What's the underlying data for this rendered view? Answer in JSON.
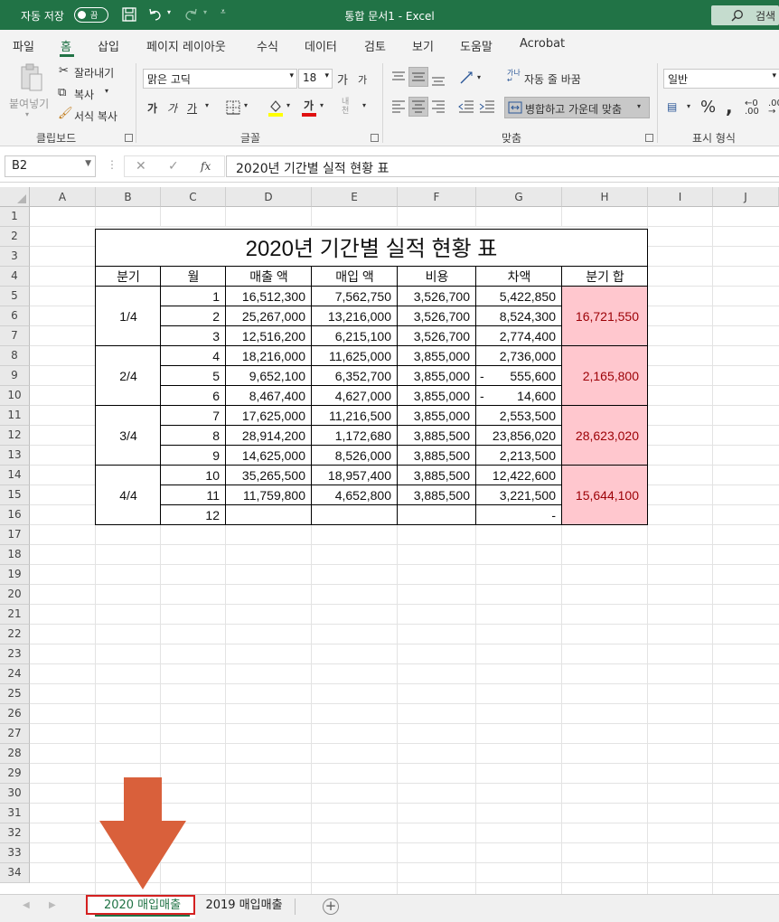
{
  "titlebar": {
    "autosave_label": "자동 저장",
    "autosave_state": "끔",
    "doc_title": "통합 문서1  -  Excel",
    "search_label": "검색",
    "accent_color": "#217346"
  },
  "ribbon_tabs": [
    "파일",
    "홈",
    "삽입",
    "페이지 레이아웃",
    "수식",
    "데이터",
    "검토",
    "보기",
    "도움말",
    "Acrobat"
  ],
  "active_tab": "홈",
  "ribbon": {
    "clipboard": {
      "paste": "붙여넣기",
      "cut": "잘라내기",
      "copy": "복사",
      "format_painter": "서식 복사",
      "label": "클립보드"
    },
    "font": {
      "font_name": "맑은 고딕",
      "font_size": "18",
      "grow": "가",
      "shrink": "가",
      "bold": "가",
      "italic": "가",
      "underline": "가",
      "font_color_glyph": "가",
      "phonetic": "내천",
      "label": "글꼴"
    },
    "alignment": {
      "wrap_text": "자동 줄 바꿈",
      "merge_center": "병합하고 가운데 맞춤",
      "label": "맞춤"
    },
    "number": {
      "format": "일반",
      "percent": "%",
      "comma": ",",
      "label": "표시 형식"
    }
  },
  "formula_bar": {
    "name_box": "B2",
    "formula": "2020년 기간별 실적 현황 표",
    "cancel": "✕",
    "enter": "✓",
    "fx": "fx"
  },
  "columns": [
    "A",
    "B",
    "C",
    "D",
    "E",
    "F",
    "G",
    "H",
    "I",
    "J"
  ],
  "rows": [
    "1",
    "2",
    "3",
    "4",
    "5",
    "6",
    "7",
    "8",
    "9",
    "10",
    "11",
    "12",
    "13",
    "14",
    "15",
    "16",
    "17",
    "18",
    "19",
    "20",
    "21",
    "22",
    "23",
    "24",
    "25",
    "26",
    "27",
    "28",
    "29",
    "30",
    "31",
    "32",
    "33",
    "34"
  ],
  "table": {
    "title": "2020년 기간별 실적 현황 표",
    "headers": [
      "분기",
      "월",
      "매출 액",
      "매입 액",
      "비용",
      "차액",
      "분기 합"
    ],
    "quarters": [
      "1/4",
      "2/4",
      "3/4",
      "4/4"
    ],
    "quarter_sums": [
      "16,721,550",
      "2,165,800",
      "28,623,020",
      "15,644,100"
    ],
    "rows": [
      [
        "1",
        "16,512,300",
        "7,562,750",
        "3,526,700",
        "5,422,850"
      ],
      [
        "2",
        "25,267,000",
        "13,216,000",
        "3,526,700",
        "8,524,300"
      ],
      [
        "3",
        "12,516,200",
        "6,215,100",
        "3,526,700",
        "2,774,400"
      ],
      [
        "4",
        "18,216,000",
        "11,625,000",
        "3,855,000",
        "2,736,000"
      ],
      [
        "5",
        "9,652,100",
        "6,352,700",
        "3,855,000",
        "555,600"
      ],
      [
        "6",
        "8,467,400",
        "4,627,000",
        "3,855,000",
        "14,600"
      ],
      [
        "7",
        "17,625,000",
        "11,216,500",
        "3,855,000",
        "2,553,500"
      ],
      [
        "8",
        "28,914,200",
        "1,172,680",
        "3,885,500",
        "23,856,020"
      ],
      [
        "9",
        "14,625,000",
        "8,526,000",
        "3,885,500",
        "2,213,500"
      ],
      [
        "10",
        "35,265,500",
        "18,957,400",
        "3,885,500",
        "12,422,600"
      ],
      [
        "11",
        "11,759,800",
        "4,652,800",
        "3,885,500",
        "3,221,500"
      ],
      [
        "12",
        "",
        "",
        "",
        "-"
      ]
    ],
    "negative_marker": "-",
    "negative_rows": [
      4,
      5
    ],
    "highlight_fill": "#ffc7ce",
    "highlight_text": "#9c0006"
  },
  "sheet_tabs": [
    "2020 매입매출",
    "2019 매입매출"
  ],
  "active_sheet": "2020 매입매출",
  "new_sheet": "+",
  "annotation": {
    "arrow_color": "#d9603b",
    "box_color": "#d42020"
  }
}
